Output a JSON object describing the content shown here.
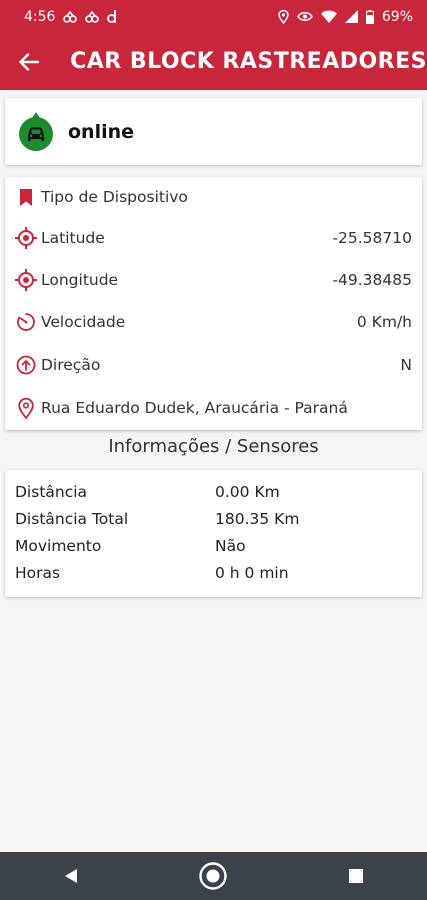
{
  "status_bar": {
    "time": "4:56",
    "battery": "69%"
  },
  "app_bar": {
    "title": "CAR BLOCK RASTREADORES"
  },
  "device_status": {
    "text": "online"
  },
  "details": {
    "device_type_label": "Tipo de Dispositivo",
    "latitude_label": "Latitude",
    "latitude_value": "-25.58710",
    "longitude_label": "Longitude",
    "longitude_value": "-49.38485",
    "speed_label": "Velocidade",
    "speed_value": "0 Km/h",
    "direction_label": "Direção",
    "direction_value": "N",
    "address": "Rua Eduardo Dudek, Araucária - Paraná"
  },
  "sensors": {
    "title": "Informações / Sensores",
    "rows": [
      {
        "label": "Distância",
        "value": "0.00 Km"
      },
      {
        "label": "Distância Total",
        "value": "180.35 Km"
      },
      {
        "label": "Movimento",
        "value": "Não"
      },
      {
        "label": "Horas",
        "value": "0 h 0 min"
      }
    ]
  },
  "colors": {
    "accent": "#c8263a",
    "status_online": "#1e8a2e",
    "nav_bar": "#3b4249"
  },
  "icons": {
    "back": "arrow-left-icon",
    "car": "car-icon",
    "bookmark": "bookmark-icon",
    "crosshair": "crosshair-icon",
    "speed": "speedometer-icon",
    "direction": "arrow-up-circle-icon",
    "location": "map-pin-icon"
  }
}
